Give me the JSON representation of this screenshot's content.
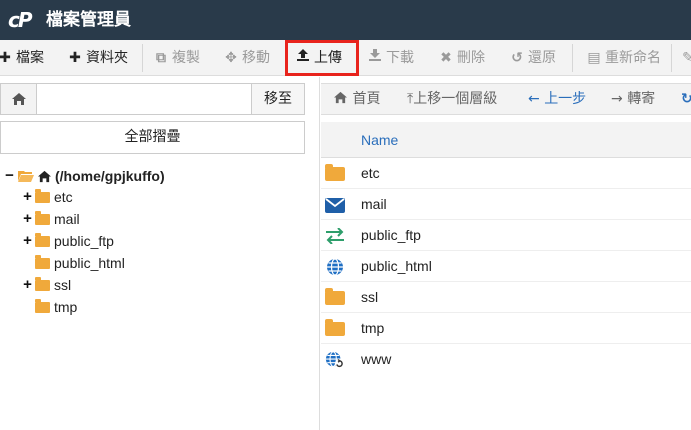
{
  "app": {
    "logo": "cP",
    "title": "檔案管理員"
  },
  "toolbar": {
    "file": "檔案",
    "folder": "資料夾",
    "copy": "複製",
    "move": "移動",
    "upload": "上傳",
    "download": "下載",
    "delete": "刪除",
    "restore": "還原",
    "rename": "重新命名"
  },
  "left": {
    "go_label": "移至",
    "path_value": "",
    "collapse_label": "全部摺疊",
    "root_label": "(/home/gpjkuffo)",
    "tree": [
      "etc",
      "mail",
      "public_ftp",
      "public_html",
      "ssl",
      "tmp"
    ]
  },
  "nav": {
    "home": "首頁",
    "up_level": "上移一個層級",
    "back": "上一步",
    "forward": "轉寄"
  },
  "table": {
    "header_name": "Name",
    "rows": [
      "etc",
      "mail",
      "public_ftp",
      "public_html",
      "ssl",
      "tmp",
      "www"
    ]
  },
  "colors": {
    "header_bg": "#293a4a",
    "highlight": "#e8231c",
    "folder": "#f0a93b",
    "link_blue": "#2a6ebb",
    "ftp_green": "#2e9e6b"
  }
}
